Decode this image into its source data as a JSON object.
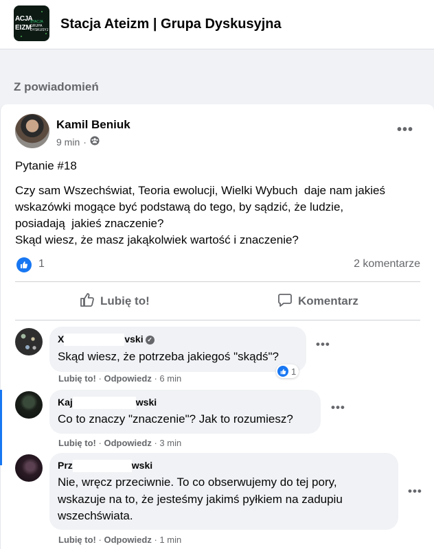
{
  "group": {
    "name": "Stacja Ateizm | Grupa Dyskusyjna",
    "logo_line1": "ACJA",
    "logo_line2": "EIZM",
    "logo_line3": "STACJA",
    "logo_line4": "GRUPA DYSKUSYJ"
  },
  "section_label": "Z powiadomień",
  "post": {
    "author": "Kamil Beniuk",
    "time": "9 min",
    "audience_icon": "group-icon",
    "more_label": "•••",
    "title": "Pytanie #18",
    "body_lines": [
      "Czy sam Wszechświat, Teoria ewolucji, Wielki Wybuch  daje nam jakieś",
      "wskazówki mogące być podstawą do tego, by sądzić, że ludzie,",
      "posiadają  jakieś znaczenie?",
      "Skąd wiesz, że masz jakąkolwiek wartość i znaczenie?"
    ],
    "reaction_count": "1",
    "comments_count": "2 komentarze",
    "like_label": "Lubię to!",
    "comment_label": "Komentarz"
  },
  "comments": [
    {
      "name_start": "X",
      "name_end": "vski",
      "verified": true,
      "text_lines": [
        "Skąd wiesz, że potrzeba jakiegoś \"skądś\"?"
      ],
      "like_label": "Lubię to!",
      "separator": "·",
      "reply_label": "Odpowiedz",
      "time": "6 min",
      "reaction_count": "1"
    },
    {
      "name_start": "Kaj",
      "name_end": "wski",
      "verified": false,
      "text_lines": [
        "Co to znaczy \"znaczenie\"? Jak to rozumiesz?"
      ],
      "like_label": "Lubię to!",
      "separator": "·",
      "reply_label": "Odpowiedz",
      "time": "3 min"
    },
    {
      "name_start": "Prz",
      "name_end": "wski",
      "verified": false,
      "text_lines": [
        "Nie, wręcz przeciwnie. To co obserwujemy do tej pory,",
        "wskazuje na to, że jesteśmy jakimś pyłkiem na zadupiu",
        "wszechświata."
      ],
      "like_label": "Lubię to!",
      "separator": "·",
      "reply_label": "Odpowiedz",
      "time": "1 min"
    }
  ],
  "colors": {
    "accent": "#1877f2",
    "secondary_text": "#65676b",
    "bubble": "#f0f2f5"
  }
}
